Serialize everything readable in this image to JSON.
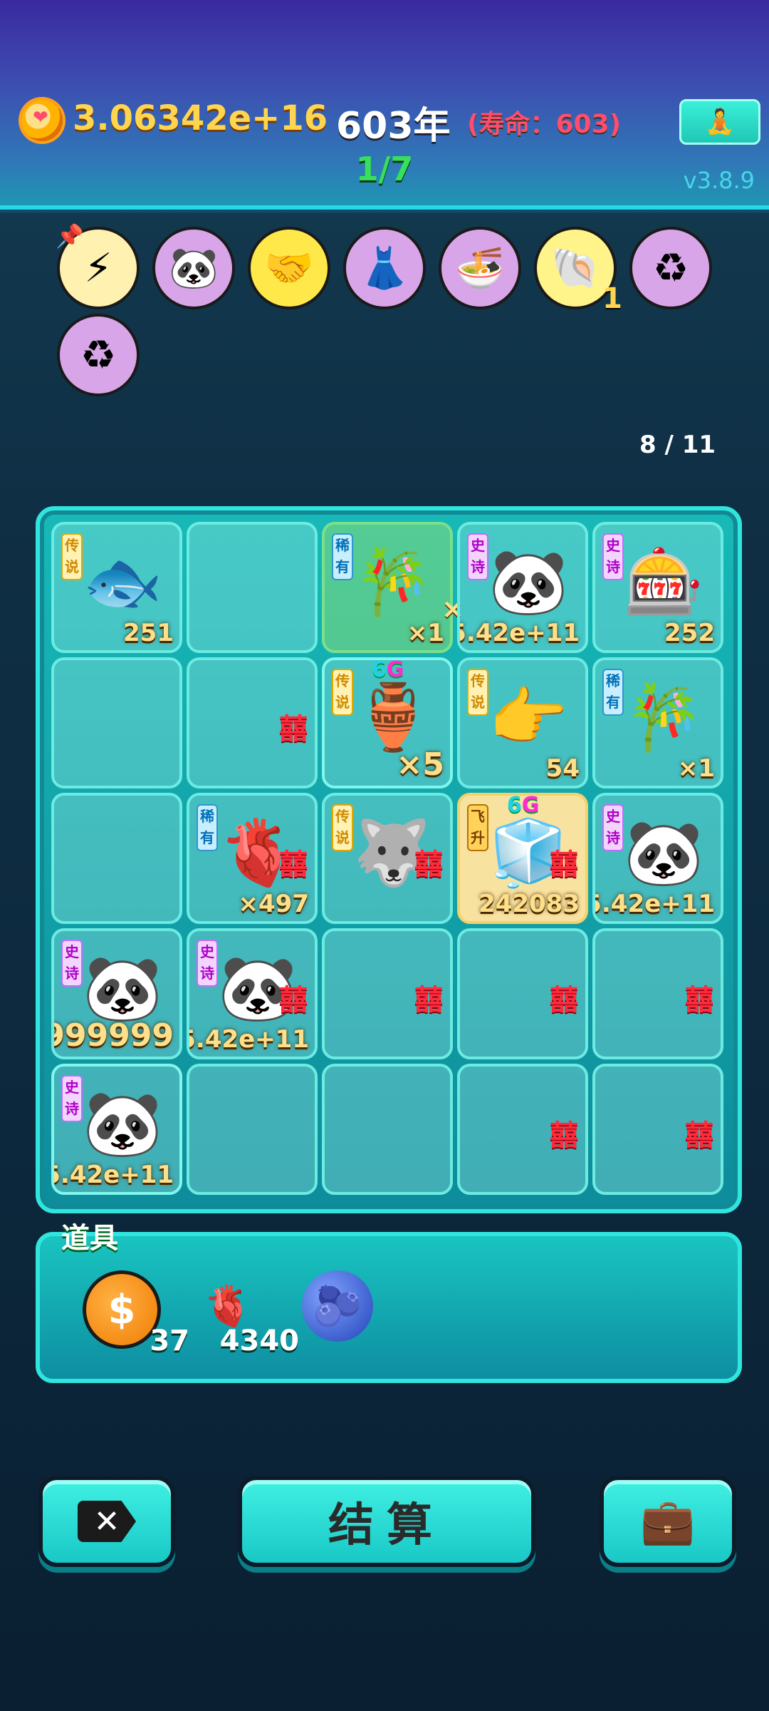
{
  "header": {
    "coins": "3.06342e+16",
    "year": "603年",
    "lifespan": "(寿命：603)",
    "progress": "1/7",
    "version": "v3.8.9",
    "meditate_icon": "🧘"
  },
  "powerups": [
    {
      "icon": "lightning-icon",
      "glyph": "⚡",
      "badge": ""
    },
    {
      "icon": "panda-icon",
      "glyph": "🐼",
      "badge": ""
    },
    {
      "icon": "handshake-icon",
      "glyph": "🤝",
      "badge": ""
    },
    {
      "icon": "skirt-icon",
      "glyph": "👗",
      "badge": ""
    },
    {
      "icon": "bowl-swap-icon",
      "glyph": "🍜",
      "badge": ""
    },
    {
      "icon": "shell-icon",
      "glyph": "🐚",
      "badge": "1"
    },
    {
      "icon": "recycle-icon",
      "glyph": "♻",
      "badge": ""
    },
    {
      "icon": "recycle-icon",
      "glyph": "♻",
      "badge": ""
    }
  ],
  "page_indicator": "8 / 11",
  "grid": [
    [
      {
        "tag": "传说",
        "tag_color": "yellow",
        "item": "koi-fish-icon",
        "glyph": "🐟",
        "count": "251"
      },
      {},
      {
        "tag": "稀有",
        "tag_color": "blue",
        "item": "crowned-bamboo-icon",
        "glyph": "🎋",
        "count": "×1",
        "highlight": "green",
        "extra": "×"
      },
      {
        "tag": "史诗",
        "tag_color": "purple",
        "item": "crowned-panda-icon",
        "glyph": "🐼",
        "count": "5.42e+11"
      },
      {
        "tag": "史诗",
        "tag_color": "purple",
        "item": "gacha-machine-icon",
        "glyph": "🎰",
        "count": "252"
      }
    ],
    [
      {},
      {
        "xi": "囍"
      },
      {
        "tag": "传说",
        "tag_color": "yellow",
        "item": "vase-icon",
        "glyph": "🏺",
        "count": "×5",
        "gtag": "6",
        "gtag_g": "G",
        "highlight": "bright",
        "count_big": true
      },
      {
        "tag": "传说",
        "tag_color": "yellow",
        "item": "pointing-hand-icon",
        "glyph": "👉",
        "count": "54"
      },
      {
        "tag": "稀有",
        "tag_color": "blue",
        "item": "crowned-bamboo-icon",
        "glyph": "🎋",
        "count": "×1"
      }
    ],
    [
      {},
      {
        "tag": "稀有",
        "tag_color": "blue",
        "item": "liver-icon",
        "glyph": "🫀",
        "count": "×497",
        "xi": "囍"
      },
      {
        "tag": "传说",
        "tag_color": "yellow",
        "item": "crowned-husky-icon",
        "glyph": "🐺",
        "count": "",
        "xi": "囍"
      },
      {
        "tag": "飞升",
        "tag_color": "orange",
        "item": "fridge-icon",
        "glyph": "🧊",
        "count": "242083",
        "xi": "囍",
        "highlight": "yellow",
        "gtag": "6",
        "gtag_g": "G"
      },
      {
        "tag": "史诗",
        "tag_color": "purple",
        "item": "crowned-panda-icon",
        "glyph": "🐼",
        "count": "5.42e+11"
      }
    ],
    [
      {
        "tag": "史诗",
        "tag_color": "purple",
        "item": "crowned-panda-icon",
        "glyph": "🐼",
        "count": "999999",
        "count_big": true
      },
      {
        "tag": "史诗",
        "tag_color": "purple",
        "item": "panda-icon",
        "glyph": "🐼",
        "count": "5.42e+11",
        "xi": "囍"
      },
      {
        "xi": "囍"
      },
      {
        "xi": "囍"
      },
      {
        "xi": "囍"
      }
    ],
    [
      {
        "tag": "史诗",
        "tag_color": "purple",
        "item": "crowned-panda-icon",
        "glyph": "🐼",
        "count": "5.42e+11",
        "highlight": "bright"
      },
      {},
      {},
      {
        "xi": "囍"
      },
      {
        "xi": "囍"
      }
    ]
  ],
  "props": {
    "title": "道具",
    "items": [
      {
        "icon": "dollar-coin-icon",
        "glyph": "$",
        "count": "37"
      },
      {
        "icon": "liver-icon",
        "glyph": "🫀",
        "count": "4340"
      },
      {
        "icon": "blueberry-icon",
        "glyph": "🫐",
        "count": ""
      }
    ]
  },
  "buttons": {
    "close_label": "✕",
    "settle_label": "结算",
    "bag_icon": "💼"
  }
}
